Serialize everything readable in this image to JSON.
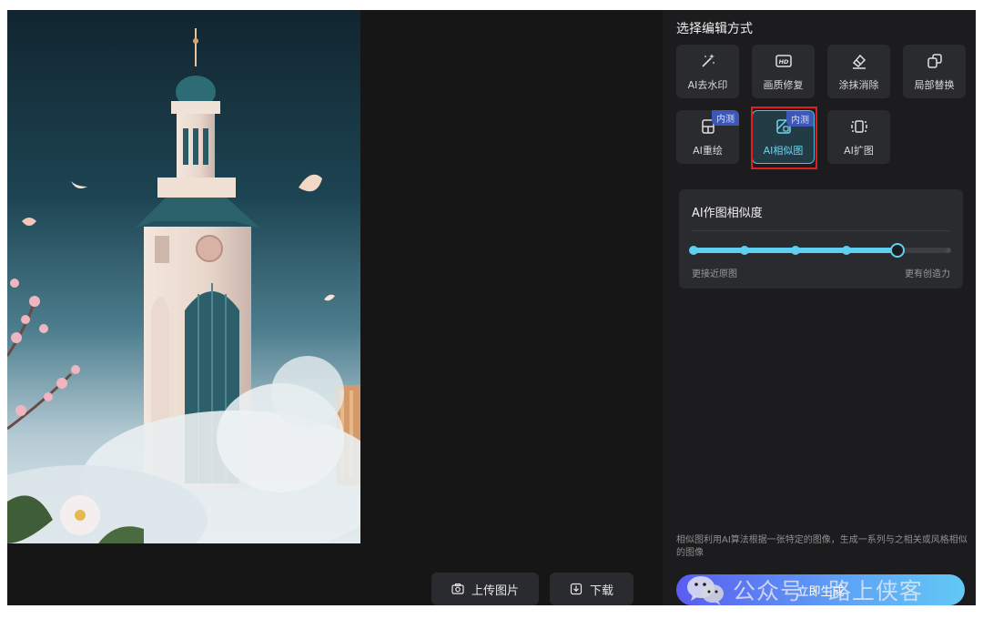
{
  "panel": {
    "title": "选择编辑方式",
    "modes": [
      {
        "label": "AI去水印",
        "icon": "magic-wand-icon"
      },
      {
        "label": "画质修复",
        "icon": "hd-icon"
      },
      {
        "label": "涂抹消除",
        "icon": "eraser-icon"
      },
      {
        "label": "局部替换",
        "icon": "replace-icon"
      },
      {
        "label": "AI重绘",
        "icon": "repaint-icon",
        "badge": "内测"
      },
      {
        "label": "AI相似图",
        "icon": "similar-image-icon",
        "badge": "内测",
        "selected": true
      },
      {
        "label": "AI扩图",
        "icon": "expand-icon"
      }
    ],
    "similarity": {
      "title": "AI作图相似度",
      "level": 0.8,
      "steps": 6,
      "min_label": "更接近原图",
      "max_label": "更有创造力"
    },
    "description": "相似图利用AI算法根据一张特定的图像，生成一系列与之相关或风格相似的图像",
    "generate_label": "立即生成"
  },
  "toolbar": {
    "upload_label": "上传图片",
    "download_label": "下载"
  },
  "watermark": {
    "text": "公众号 · 路上侠客"
  },
  "colors": {
    "accent": "#5fd0f0",
    "panel_bg": "#1c1c1e",
    "canvas_bg": "#161617",
    "badge": "#3d57b8",
    "highlight": "#e02020"
  }
}
